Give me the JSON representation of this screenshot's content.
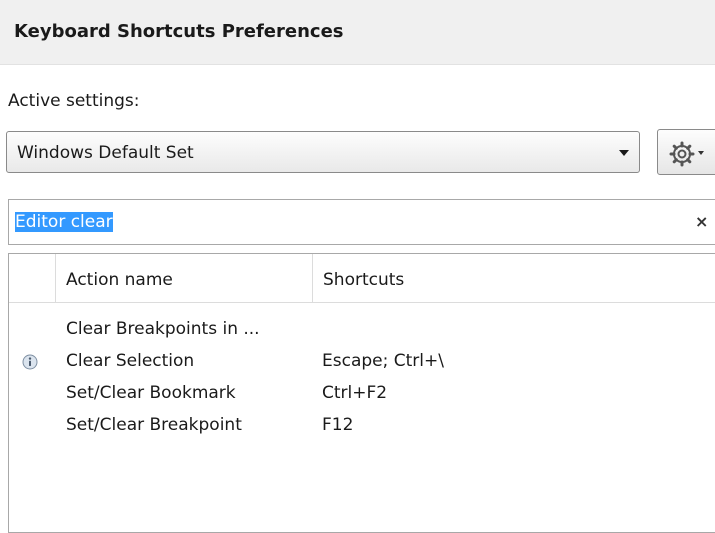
{
  "window": {
    "title": "Keyboard Shortcuts Preferences"
  },
  "settings": {
    "label": "Active settings:",
    "selected": "Windows Default Set",
    "menu_icon": "gear-icon"
  },
  "filter": {
    "value": "Editor clear",
    "clear_icon": "close-icon",
    "clear_glyph": "×"
  },
  "table": {
    "columns": [
      "",
      "Action name",
      "Shortcuts"
    ],
    "rows": [
      {
        "icon": "",
        "action": "Clear Breakpoints in ...",
        "shortcut": ""
      },
      {
        "icon": "info-icon",
        "action": "Clear Selection",
        "shortcut": "Escape; Ctrl+\\"
      },
      {
        "icon": "",
        "action": "Set/Clear Bookmark",
        "shortcut": "Ctrl+F2"
      },
      {
        "icon": "",
        "action": "Set/Clear Breakpoint",
        "shortcut": "F12"
      }
    ]
  },
  "colors": {
    "selection": "#3399ff",
    "title_bar": "#f0f0f0"
  }
}
